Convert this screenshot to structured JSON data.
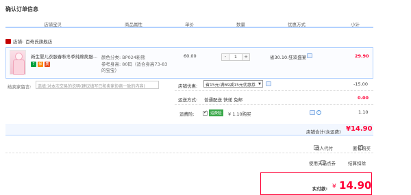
{
  "page": {
    "title": "确认订单信息"
  },
  "columns": [
    "店铺宝贝",
    "商品属性",
    "单价",
    "数量",
    "优惠方式",
    "小计"
  ],
  "shop": {
    "label": "店铺:",
    "name": "百奇氏旗舰店"
  },
  "item": {
    "name": "新生婴儿衣服春秋冬季纯棉爬服...",
    "attr_color": "颜色分类: BP024粉熊",
    "attr_size_line1": "参考身高: 80码（适合身高73-83",
    "attr_size_line2": "的宝宝）",
    "unit_price": "60.00",
    "quantity": "1",
    "minus": "-",
    "plus": "+",
    "discount": "省30.10:狂欢盛宴",
    "subtotal": "29.90",
    "badges": [
      "7",
      "保",
      "质"
    ],
    "badge_colors": [
      "#00a03e",
      "#ff8a00",
      "#e84d1c"
    ]
  },
  "message": {
    "label": "给卖家留言:",
    "placeholder": "选填:对本次交易的说明(建议填写已和卖家协商一致的内容)"
  },
  "promo": {
    "label": "店铺优惠:",
    "selected": "省15元:满69减15元优惠券",
    "amount": "-15.00"
  },
  "shipping": {
    "label": "运送方式:",
    "value": "普通配送 快递 免邮",
    "amount": "0.00"
  },
  "insurance": {
    "label": "运费险:",
    "tag": "运费险",
    "price": "¥ 1.10购买",
    "amount": "1.10"
  },
  "store_total": {
    "label": "店铺合计(含运费)",
    "value": "¥14.90"
  },
  "options": {
    "proxy_pay": "找人代付",
    "anonymous": "匿名购买",
    "tmall_points": "使用天猫点券",
    "points_note": "结算扣除"
  },
  "payment": {
    "label": "实付款:",
    "currency": "¥",
    "value": "14.90"
  }
}
